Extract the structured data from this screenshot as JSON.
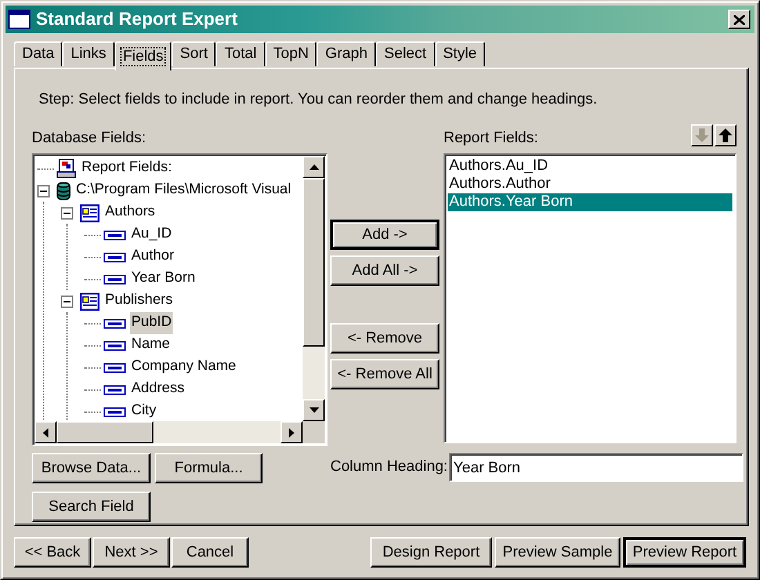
{
  "window": {
    "title": "Standard Report Expert"
  },
  "tabs": [
    {
      "label": "Data",
      "selected": false
    },
    {
      "label": "Links",
      "selected": false
    },
    {
      "label": "Fields",
      "selected": true
    },
    {
      "label": "Sort",
      "selected": false
    },
    {
      "label": "Total",
      "selected": false
    },
    {
      "label": "TopN",
      "selected": false
    },
    {
      "label": "Graph",
      "selected": false
    },
    {
      "label": "Select",
      "selected": false
    },
    {
      "label": "Style",
      "selected": false
    }
  ],
  "step_text": "Step:  Select fields to include in report.  You can reorder them and change headings.",
  "database_fields": {
    "label": "Database Fields:",
    "tree": [
      {
        "label": "Report Fields:",
        "kind": "report",
        "selected": false
      },
      {
        "label": "C:\\Program Files\\Microsoft Visual",
        "kind": "database",
        "expanded": true,
        "selected": false,
        "children": [
          {
            "label": "Authors",
            "kind": "table",
            "expanded": true,
            "selected": false,
            "children": [
              {
                "label": "Au_ID",
                "kind": "field",
                "selected": false
              },
              {
                "label": "Author",
                "kind": "field",
                "selected": false
              },
              {
                "label": "Year Born",
                "kind": "field",
                "selected": false
              }
            ]
          },
          {
            "label": "Publishers",
            "kind": "table",
            "expanded": true,
            "selected": false,
            "children": [
              {
                "label": "PubID",
                "kind": "field",
                "selected": true
              },
              {
                "label": "Name",
                "kind": "field",
                "selected": false
              },
              {
                "label": "Company Name",
                "kind": "field",
                "selected": false
              },
              {
                "label": "Address",
                "kind": "field",
                "selected": false
              },
              {
                "label": "City",
                "kind": "field",
                "selected": false
              }
            ]
          }
        ]
      }
    ]
  },
  "transfer_buttons": [
    {
      "label": "Add ->",
      "default": true
    },
    {
      "label": "Add All ->",
      "default": false
    },
    {
      "label": "<- Remove",
      "default": false
    },
    {
      "label": "<- Remove All",
      "default": false
    }
  ],
  "report_fields": {
    "label": "Report Fields:",
    "move_buttons": [
      {
        "kind": "down",
        "disabled": true
      },
      {
        "kind": "up",
        "disabled": false
      }
    ],
    "items": [
      {
        "label": "Authors.Au_ID",
        "selected": false
      },
      {
        "label": "Authors.Author",
        "selected": false
      },
      {
        "label": "Authors.Year Born",
        "selected": true
      }
    ]
  },
  "field_buttons": [
    {
      "label": "Browse Data..."
    },
    {
      "label": "Formula..."
    },
    {
      "label": "Search Field"
    }
  ],
  "column_heading": {
    "label": "Column Heading:",
    "value": "Year Born"
  },
  "footer_left": [
    {
      "label": "<< Back",
      "default": false
    },
    {
      "label": "Next >>",
      "default": false
    },
    {
      "label": "Cancel",
      "default": false
    }
  ],
  "footer_right": [
    {
      "label": "Design Report",
      "default": false
    },
    {
      "label": "Preview Sample",
      "default": false
    },
    {
      "label": "Preview Report",
      "default": true
    }
  ]
}
